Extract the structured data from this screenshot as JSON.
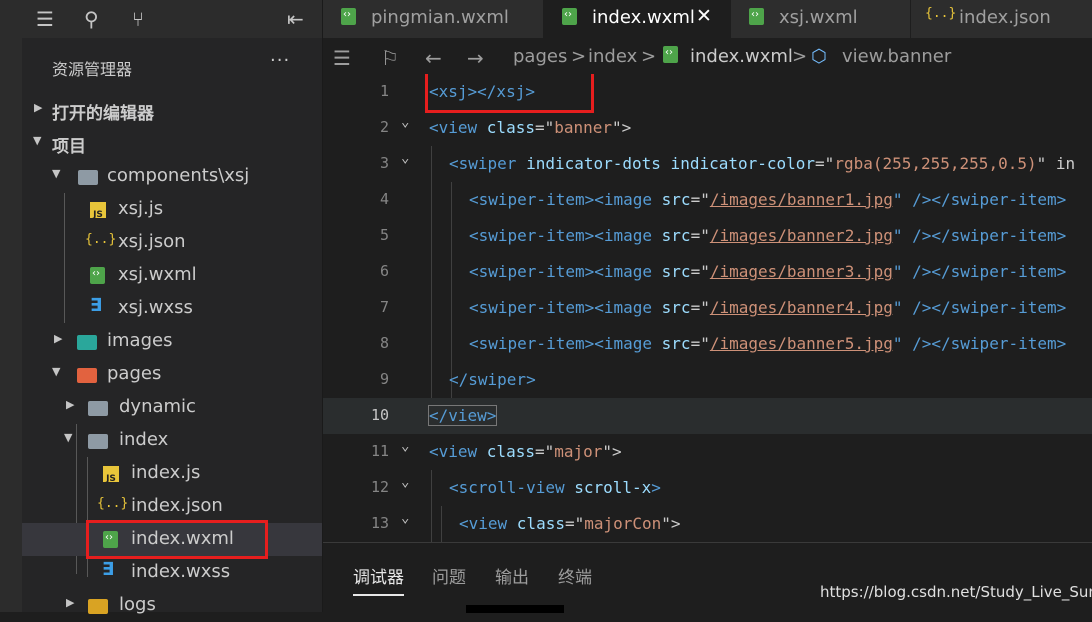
{
  "sidebar": {
    "title": "资源管理器",
    "more": "···",
    "sections": {
      "open_editors": "打开的编辑器",
      "project": "项目"
    },
    "tree": [
      {
        "label": "components\\xsj",
        "icon": "folder"
      },
      {
        "label": "xsj.js",
        "icon": "js-file"
      },
      {
        "label": "xsj.json",
        "icon": "json-file"
      },
      {
        "label": "xsj.wxml",
        "icon": "wxml-file"
      },
      {
        "label": "xsj.wxss",
        "icon": "wxss-file"
      },
      {
        "label": "images",
        "icon": "folder-images"
      },
      {
        "label": "pages",
        "icon": "folder-pages"
      },
      {
        "label": "dynamic",
        "icon": "folder"
      },
      {
        "label": "index",
        "icon": "folder"
      },
      {
        "label": "index.js",
        "icon": "js-file"
      },
      {
        "label": "index.json",
        "icon": "json-file"
      },
      {
        "label": "index.wxml",
        "icon": "wxml-file",
        "selected": true
      },
      {
        "label": "index.wxss",
        "icon": "wxss-file"
      },
      {
        "label": "logs",
        "icon": "folder-logs"
      }
    ],
    "js_badge": "JS",
    "json_badge": "{..}",
    "wxss_badge": "∃"
  },
  "tabs": [
    {
      "label": "pingmian.wxml",
      "active": false
    },
    {
      "label": "index.wxml",
      "active": true
    },
    {
      "label": "xsj.wxml",
      "active": false
    },
    {
      "label": "index.json",
      "active": false
    }
  ],
  "tab_close": "✕",
  "breadcrumb": {
    "p1": "pages",
    "sep": ">",
    "p2": "index",
    "p3": "index.wxml",
    "p4": "view.banner"
  },
  "editor": {
    "line_numbers": [
      "1",
      "2",
      "3",
      "4",
      "5",
      "6",
      "7",
      "8",
      "9",
      "10",
      "11",
      "12",
      "13"
    ],
    "lines": [
      [
        "<xsj></xsj>"
      ],
      [
        "<view ",
        "class",
        "=\"",
        "banner",
        "\">"
      ],
      [
        "<swiper ",
        "indicator-dots indicator-color",
        "=\"",
        "rgba(255,255,255,0.5)",
        "\" in"
      ],
      [
        "<swiper-item><image ",
        "src",
        "=\"",
        "/images/banner1.jpg",
        "\" /></swiper-item>"
      ],
      [
        "<swiper-item><image ",
        "src",
        "=\"",
        "/images/banner2.jpg",
        "\" /></swiper-item>"
      ],
      [
        "<swiper-item><image ",
        "src",
        "=\"",
        "/images/banner3.jpg",
        "\" /></swiper-item>"
      ],
      [
        "<swiper-item><image ",
        "src",
        "=\"",
        "/images/banner4.jpg",
        "\" /></swiper-item>"
      ],
      [
        "<swiper-item><image ",
        "src",
        "=\"",
        "/images/banner5.jpg",
        "\" /></swiper-item>"
      ],
      [
        "</swiper>"
      ],
      [
        "</view>"
      ],
      [
        "<view ",
        "class",
        "=\"",
        "major",
        "\">"
      ],
      [
        "<scroll-view ",
        "scroll-x",
        ">"
      ],
      [
        "<view ",
        "class",
        "=\"",
        "majorCon",
        "\">"
      ]
    ]
  },
  "panel": {
    "tabs": [
      "调试器",
      "问题",
      "输出",
      "终端"
    ],
    "watermark": "https://blog.csdn.net/Study_Live_Sun"
  },
  "colors": {
    "highlight_box": "#e61e1e",
    "tag": "#569cd6",
    "string": "#ce9178",
    "attr": "#9cdcfe"
  }
}
